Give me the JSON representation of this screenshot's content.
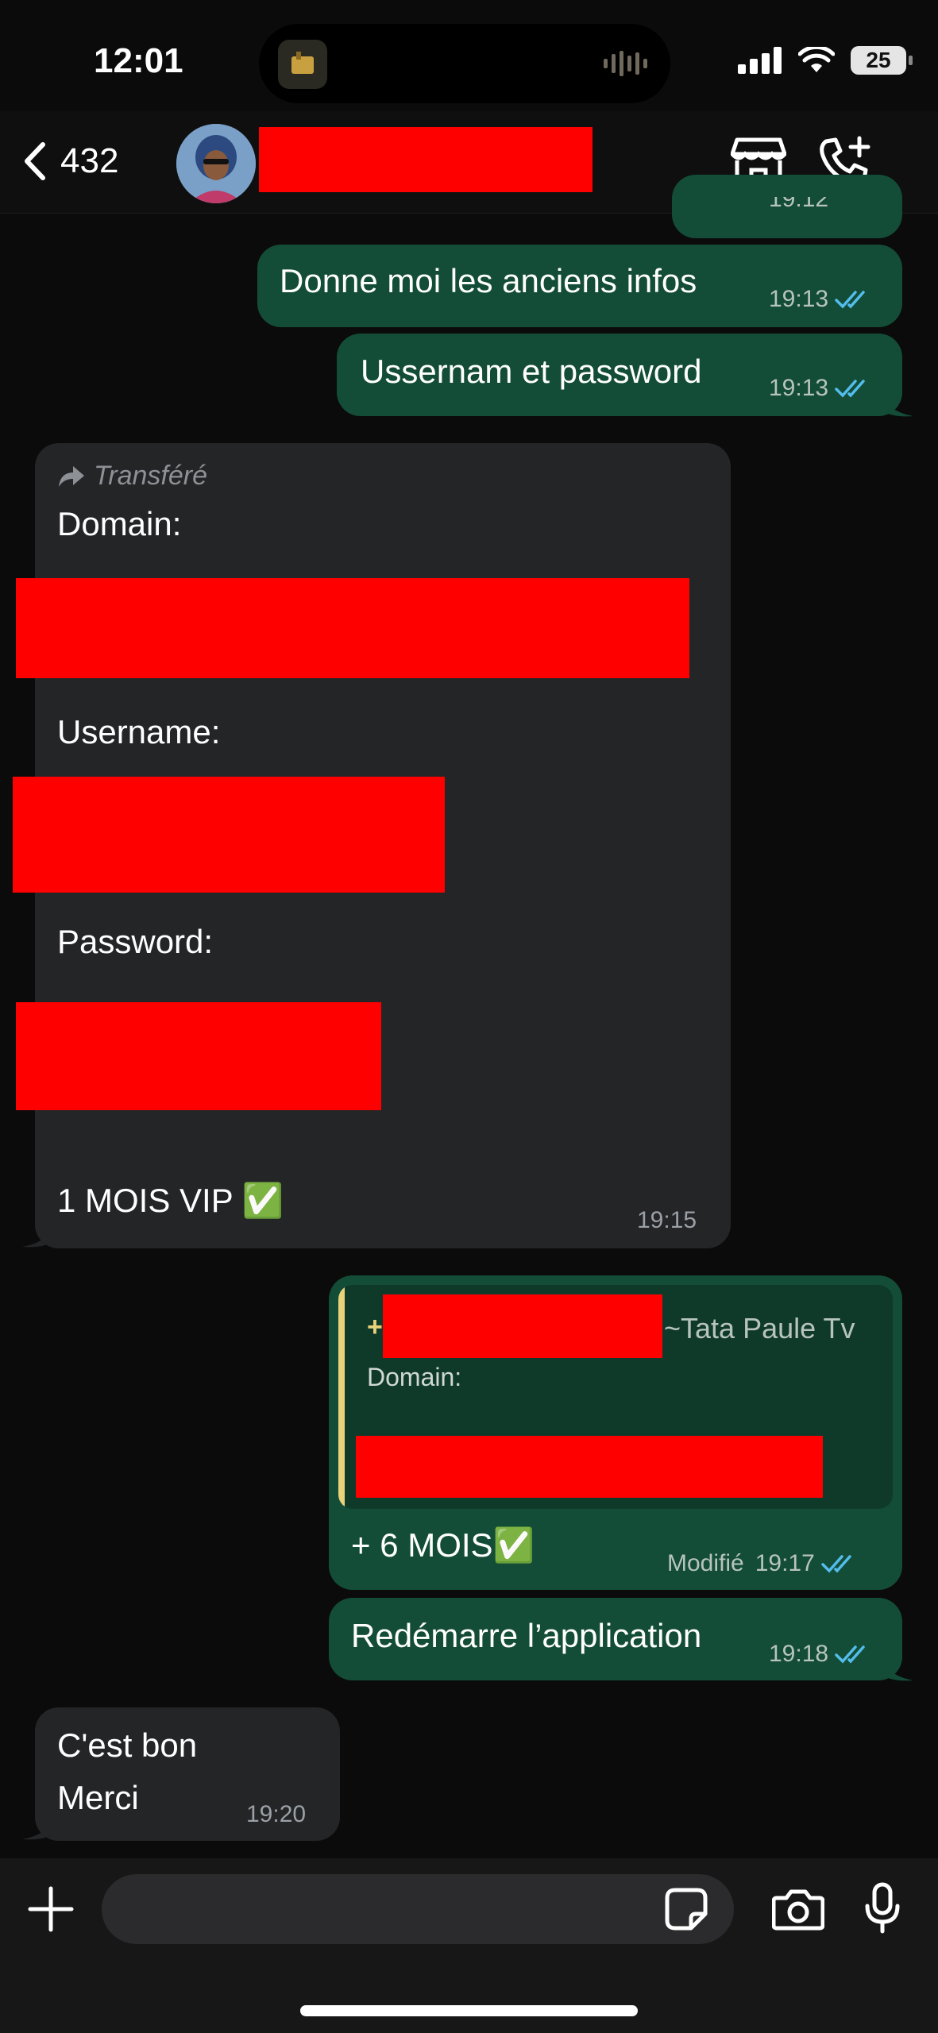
{
  "status": {
    "time": "12:01",
    "battery": "25"
  },
  "header": {
    "back_count": "432"
  },
  "messages": {
    "m1": {
      "text": "Donne moi les anciens infos",
      "time": "19:13"
    },
    "m2": {
      "text": "Ussernam et password",
      "time": "19:13"
    },
    "m3": {
      "forwarded": "Transféré",
      "domain_label": "Domain:",
      "username_label": "Username:",
      "password_label": "Password:",
      "footer": "1 MOIS VIP ✅",
      "time": "19:15"
    },
    "m4": {
      "reply_author_suffix": "~Tata Paule Tv",
      "reply_plus": "+",
      "reply_text": "Domain:",
      "text": "+ 6 MOIS✅",
      "edited": "Modifié",
      "time": "19:17"
    },
    "m5": {
      "text": "Redémarre l’application",
      "time": "19:18"
    },
    "m6": {
      "line1": "C'est bon",
      "line2": "Merci",
      "time": "19:20"
    },
    "partial_time": "19:12"
  },
  "colors": {
    "outgoing": "#134d37",
    "incoming": "#242527",
    "read_ticks": "#53bdeb",
    "redaction": "#ff0000"
  }
}
